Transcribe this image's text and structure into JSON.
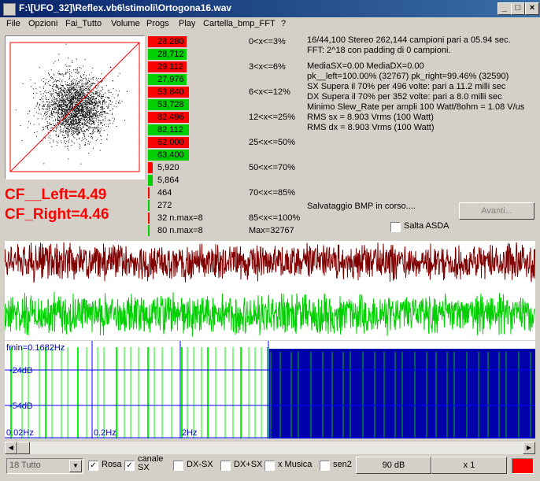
{
  "window": {
    "title": "F:\\[UFO_32]\\Reflex.vb6\\stimoli\\Ortogona16.wav",
    "min_glyph": "_",
    "max_glyph": "□",
    "close_glyph": "×"
  },
  "menu": [
    "File",
    "Opzioni",
    "Fai_Tutto",
    "Volume",
    "Progs",
    "Play",
    "Cartella_bmp_FFT",
    "?"
  ],
  "crest": {
    "left": "CF__Left=4.49",
    "right": "CF_Right=4.46"
  },
  "histogram": {
    "rows": [
      {
        "value": "28,280",
        "range": "0<x<=3%",
        "fill": 0.95,
        "color": "#ff0000"
      },
      {
        "value": "28,712",
        "range": "",
        "fill": 0.95,
        "color": "#00d000"
      },
      {
        "value": "29,112",
        "range": "3<x<=6%",
        "fill": 0.95,
        "color": "#ff0000"
      },
      {
        "value": "27,976",
        "range": "",
        "fill": 0.95,
        "color": "#00d000"
      },
      {
        "value": "53,840",
        "range": "6<x<=12%",
        "fill": 1.0,
        "color": "#ff0000"
      },
      {
        "value": "53,728",
        "range": "",
        "fill": 1.0,
        "color": "#00d000"
      },
      {
        "value": "82,496",
        "range": "12<x<=25%",
        "fill": 1.0,
        "color": "#ff0000"
      },
      {
        "value": "82,112",
        "range": "",
        "fill": 1.0,
        "color": "#00d000"
      },
      {
        "value": "62,000",
        "range": "25<x<=50%",
        "fill": 1.0,
        "color": "#ff0000"
      },
      {
        "value": "63,400",
        "range": "",
        "fill": 1.0,
        "color": "#00d000"
      },
      {
        "value": "5,920",
        "range": "50<x<=70%",
        "fill": 0.12,
        "color": "#ff0000"
      },
      {
        "value": "5,864",
        "range": "",
        "fill": 0.12,
        "color": "#00d000"
      },
      {
        "value": "464",
        "range": "70<x<=85%",
        "fill": 0.02,
        "color": "#ff0000"
      },
      {
        "value": "272",
        "range": "",
        "fill": 0.02,
        "color": "#00d000"
      },
      {
        "value": "32 n.max=8",
        "range": "85<x<=100%",
        "fill": 0.02,
        "color": "#ff0000"
      },
      {
        "value": "80 n.max=8",
        "range": "Max=32767",
        "fill": 0.02,
        "color": "#00d000"
      }
    ]
  },
  "info_top": [
    "16/44,100 Stereo 262,144 campioni pari a 05.94 sec.",
    "FFT: 2^18 con padding di 0 campioni."
  ],
  "info_main": [
    "MediaSX=0.00  MediaDX=0.00",
    "pk__left=100.00% (32767)  pk_right=99.46% (32590)",
    "SX Supera il 70% per 496 volte: pari a 11.2 milli sec",
    "DX Supera il 70% per 352 volte: pari a 8.0 milli sec",
    "Minimo Slew_Rate per ampli 100 Watt/8ohm = 1.08 V/us",
    "RMS sx = 8.903 Vrms (100 Watt)",
    "RMS dx = 8.903 Vrms (100 Watt)"
  ],
  "save_status": "Salvataggio BMP in corso....",
  "avanti_label": "Avanti...",
  "salta_label": "Salta ASDA",
  "spectrum": {
    "fmin": "fmin=0.1682Hz",
    "db1": "-24dB",
    "db2": "-54dB",
    "x_labels": [
      "0.02Hz",
      "0.2Hz",
      "2Hz",
      "2"
    ]
  },
  "colors": {
    "waveform_left": "#800000",
    "waveform_right": "#00d000",
    "spectrum_fill": "#0000aa",
    "spectrum_line": "#00ff00",
    "grid": "#0000ff",
    "indicator": "#ff0000"
  },
  "bottom": {
    "select_value": "18 Tutto",
    "rosa": "Rosa",
    "canale": "canale SX",
    "dxsx": "DX-SX",
    "dxpsx": "DX+SX",
    "xmusica": "x Musica",
    "sen2": "sen2",
    "db_btn": "90 dB",
    "x_btn": "x 1"
  },
  "checks": {
    "rosa": true,
    "canale": true,
    "dxsx": false,
    "dxpsx": false,
    "xmusica": false,
    "sen2": false,
    "salta": false
  }
}
